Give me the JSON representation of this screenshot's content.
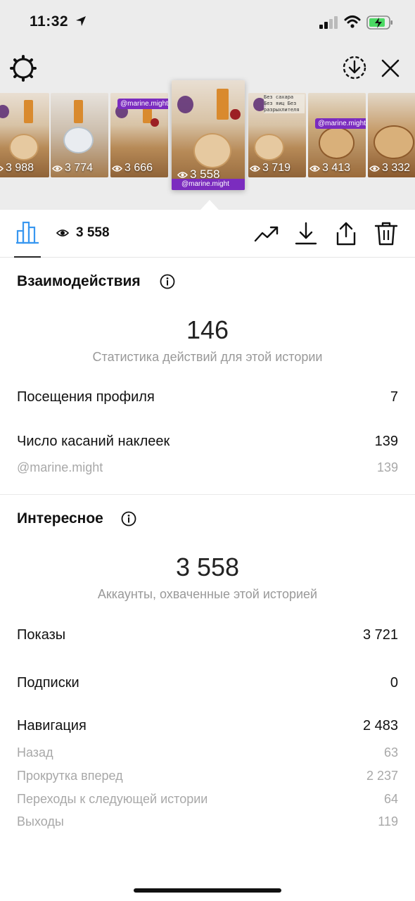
{
  "status_bar": {
    "time": "11:32",
    "icons": [
      "location-arrow-icon",
      "signal-icon",
      "wifi-icon",
      "battery-charging-icon"
    ]
  },
  "top_bar": {
    "left_icon": "gear-icon",
    "right_icons": [
      "save-story-icon",
      "close-icon"
    ]
  },
  "stories": [
    {
      "views": "3 988",
      "selected": false
    },
    {
      "views": "3 774",
      "selected": false
    },
    {
      "views": "3 666",
      "selected": false,
      "tag": "@marine.might"
    },
    {
      "views": "3 558",
      "selected": true,
      "handle": "@marine.might"
    },
    {
      "views": "3 719",
      "selected": false,
      "note": "Без сахара Без яиц Без разрыхлителя"
    },
    {
      "views": "3 413",
      "selected": false,
      "tag": "@marine.might"
    },
    {
      "views": "3 332",
      "selected": false
    }
  ],
  "toolbar": {
    "views_count": "3 558",
    "icons": [
      "bar-chart-icon",
      "eye-icon",
      "trending-icon",
      "download-icon",
      "share-icon",
      "trash-icon"
    ]
  },
  "interactions": {
    "title": "Взаимодействия",
    "total": "146",
    "total_caption": "Статистика действий для этой истории",
    "rows": [
      {
        "label": "Посещения профиля",
        "value": "7"
      },
      {
        "label": "Число касаний наклеек",
        "value": "139"
      },
      {
        "label": "@marine.might",
        "value": "139",
        "sub": true
      }
    ]
  },
  "discovery": {
    "title": "Интересное",
    "total": "3 558",
    "total_caption": "Аккаунты, охваченные этой историей",
    "rows": [
      {
        "label": "Показы",
        "value": "3 721"
      },
      {
        "label": "Подписки",
        "value": "0"
      },
      {
        "label": "Навигация",
        "value": "2 483"
      },
      {
        "label": "Назад",
        "value": "63",
        "sub": true
      },
      {
        "label": "Прокрутка вперед",
        "value": "2 237",
        "sub": true
      },
      {
        "label": "Переходы к следующей истории",
        "value": "64",
        "sub": true
      },
      {
        "label": "Выходы",
        "value": "119",
        "sub": true
      }
    ]
  },
  "colors": {
    "accent_blue": "#3897f0",
    "tag_purple": "#7b2cbf",
    "muted_text": "#999999"
  }
}
